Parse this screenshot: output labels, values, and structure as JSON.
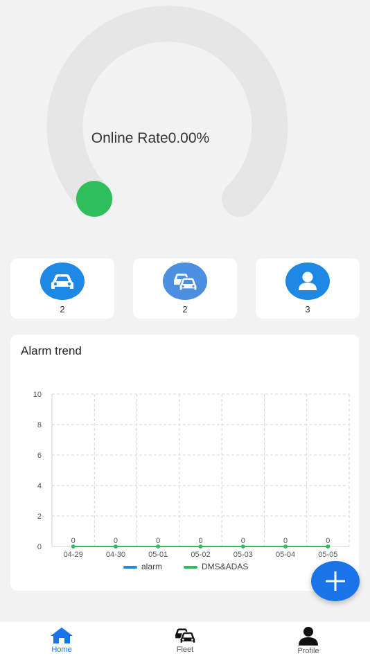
{
  "gauge": {
    "label": "Online Rate",
    "value_text": "0.00%",
    "value": 0,
    "track_color": "#e6e6e6",
    "indicator_color": "#2dbf5a"
  },
  "stats": [
    {
      "icon": "car-icon",
      "count": "2"
    },
    {
      "icon": "fleet-icon",
      "count": "2"
    },
    {
      "icon": "person-icon",
      "count": "3"
    }
  ],
  "chart_data": {
    "type": "line",
    "title": "Alarm trend",
    "categories": [
      "04-29",
      "04-30",
      "05-01",
      "05-02",
      "05-03",
      "05-04",
      "05-05"
    ],
    "ylim": [
      0,
      10
    ],
    "yticks": [
      "0",
      "2",
      "4",
      "6",
      "8",
      "10"
    ],
    "grid": true,
    "legend": "bottom-center",
    "series": [
      {
        "name": "alarm",
        "color": "#1e88e5",
        "values": [
          0,
          0,
          0,
          0,
          0,
          0,
          0
        ]
      },
      {
        "name": "DMS&ADAS",
        "color": "#2dbf5a",
        "values": [
          0,
          0,
          0,
          0,
          0,
          0,
          0
        ]
      }
    ],
    "data_labels": [
      "0",
      "0",
      "0",
      "0",
      "0",
      "0",
      "0"
    ]
  },
  "fab": {
    "icon": "plus-icon"
  },
  "tabs": [
    {
      "label": "Home",
      "icon": "home-icon",
      "active": true
    },
    {
      "label": "Fleet",
      "icon": "fleet-icon",
      "active": false
    },
    {
      "label": "Profile",
      "icon": "person-icon",
      "active": false
    }
  ],
  "colors": {
    "accent": "#1a73e8",
    "icon_blue": "#1e88e5",
    "fleet_blue": "#4a8fe0"
  }
}
